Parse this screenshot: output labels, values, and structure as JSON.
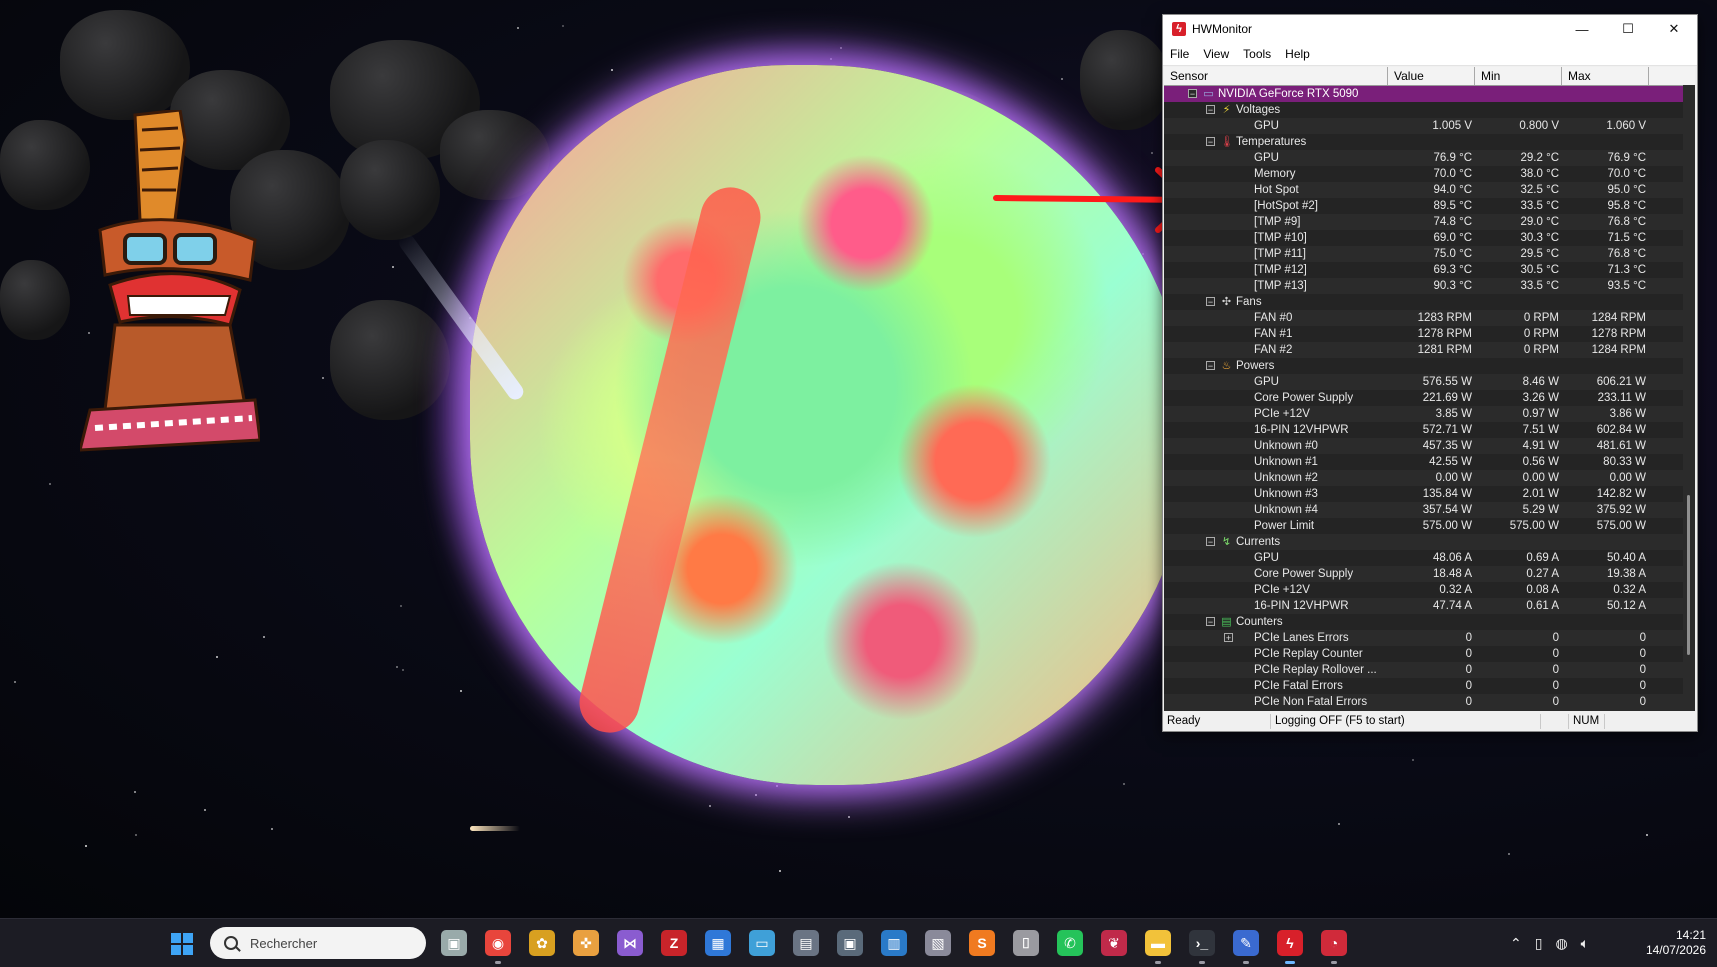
{
  "window": {
    "title": "HWMonitor",
    "menu": [
      "File",
      "View",
      "Tools",
      "Help"
    ],
    "columns": [
      "Sensor",
      "Value",
      "Min",
      "Max"
    ],
    "device": "NVIDIA GeForce RTX 5090",
    "groups": [
      {
        "name": "Voltages",
        "icon": "voltage-icon",
        "rows": [
          {
            "label": "GPU",
            "value": "1.005 V",
            "min": "0.800 V",
            "max": "1.060 V"
          }
        ]
      },
      {
        "name": "Temperatures",
        "icon": "thermometer-icon",
        "rows": [
          {
            "label": "GPU",
            "value": "76.9 °C",
            "min": "29.2 °C",
            "max": "76.9 °C"
          },
          {
            "label": "Memory",
            "value": "70.0 °C",
            "min": "38.0 °C",
            "max": "70.0 °C"
          },
          {
            "label": "Hot Spot",
            "value": "94.0 °C",
            "min": "32.5 °C",
            "max": "95.0 °C"
          },
          {
            "label": "[HotSpot #2]",
            "value": "89.5 °C",
            "min": "33.5 °C",
            "max": "95.8 °C"
          },
          {
            "label": "[TMP #9]",
            "value": "74.8 °C",
            "min": "29.0 °C",
            "max": "76.8 °C"
          },
          {
            "label": "[TMP #10]",
            "value": "69.0 °C",
            "min": "30.3 °C",
            "max": "71.5 °C"
          },
          {
            "label": "[TMP #11]",
            "value": "75.0 °C",
            "min": "29.5 °C",
            "max": "76.8 °C"
          },
          {
            "label": "[TMP #12]",
            "value": "69.3 °C",
            "min": "30.5 °C",
            "max": "71.3 °C"
          },
          {
            "label": "[TMP #13]",
            "value": "90.3 °C",
            "min": "33.5 °C",
            "max": "93.5 °C"
          }
        ]
      },
      {
        "name": "Fans",
        "icon": "fan-icon",
        "rows": [
          {
            "label": "FAN #0",
            "value": "1283 RPM",
            "min": "0 RPM",
            "max": "1284 RPM"
          },
          {
            "label": "FAN #1",
            "value": "1278 RPM",
            "min": "0 RPM",
            "max": "1278 RPM"
          },
          {
            "label": "FAN #2",
            "value": "1281 RPM",
            "min": "0 RPM",
            "max": "1284 RPM"
          }
        ]
      },
      {
        "name": "Powers",
        "icon": "flame-icon",
        "rows": [
          {
            "label": "GPU",
            "value": "576.55 W",
            "min": "8.46 W",
            "max": "606.21 W"
          },
          {
            "label": "Core Power Supply",
            "value": "221.69 W",
            "min": "3.26 W",
            "max": "233.11 W"
          },
          {
            "label": "PCIe +12V",
            "value": "3.85 W",
            "min": "0.97 W",
            "max": "3.86 W"
          },
          {
            "label": "16-PIN 12VHPWR",
            "value": "572.71 W",
            "min": "7.51 W",
            "max": "602.84 W"
          },
          {
            "label": "Unknown #0",
            "value": "457.35 W",
            "min": "4.91 W",
            "max": "481.61 W"
          },
          {
            "label": "Unknown #1",
            "value": "42.55 W",
            "min": "0.56 W",
            "max": "80.33 W"
          },
          {
            "label": "Unknown #2",
            "value": "0.00 W",
            "min": "0.00 W",
            "max": "0.00 W"
          },
          {
            "label": "Unknown #3",
            "value": "135.84 W",
            "min": "2.01 W",
            "max": "142.82 W"
          },
          {
            "label": "Unknown #4",
            "value": "357.54 W",
            "min": "5.29 W",
            "max": "375.92 W"
          },
          {
            "label": "Power Limit",
            "value": "575.00 W",
            "min": "575.00 W",
            "max": "575.00 W"
          }
        ]
      },
      {
        "name": "Currents",
        "icon": "current-icon",
        "rows": [
          {
            "label": "GPU",
            "value": "48.06 A",
            "min": "0.69 A",
            "max": "50.40 A"
          },
          {
            "label": "Core Power Supply",
            "value": "18.48 A",
            "min": "0.27 A",
            "max": "19.38 A"
          },
          {
            "label": "PCIe +12V",
            "value": "0.32 A",
            "min": "0.08 A",
            "max": "0.32 A"
          },
          {
            "label": "16-PIN 12VHPWR",
            "value": "47.74 A",
            "min": "0.61 A",
            "max": "50.12 A"
          }
        ]
      },
      {
        "name": "Counters",
        "icon": "counter-icon",
        "rows": [
          {
            "label": "PCIe Lanes Errors",
            "value": "0",
            "min": "0",
            "max": "0",
            "expandable": true
          },
          {
            "label": "PCIe Replay Counter",
            "value": "0",
            "min": "0",
            "max": "0"
          },
          {
            "label": "PCIe Replay Rollover ...",
            "value": "0",
            "min": "0",
            "max": "0"
          },
          {
            "label": "PCIe Fatal Errors",
            "value": "0",
            "min": "0",
            "max": "0"
          },
          {
            "label": "PCIe Non Fatal Errors",
            "value": "0",
            "min": "0",
            "max": "0"
          }
        ]
      }
    ],
    "status": {
      "ready": "Ready",
      "logging": "Logging OFF (F5 to start)",
      "num": "NUM"
    }
  },
  "taskbar": {
    "search_placeholder": "Rechercher",
    "apps": [
      "task-view",
      "chrome",
      "app-multicolor",
      "app-gamepad",
      "visual-studio",
      "filezilla",
      "microsoft-store",
      "remote-desktop",
      "calculator",
      "network-monitor",
      "system-monitor",
      "device-manager",
      "sublime-text",
      "usb-tool",
      "whatsapp",
      "raspberry",
      "file-explorer",
      "terminal",
      "text-editor",
      "hwmonitor",
      "gauge-app"
    ],
    "time": "14:21",
    "date": "14/07/2026"
  },
  "colors": {
    "device_row": "#7a1f7a",
    "grid_bg": "#2b2b2b",
    "annotation": "#ff1a1a"
  }
}
